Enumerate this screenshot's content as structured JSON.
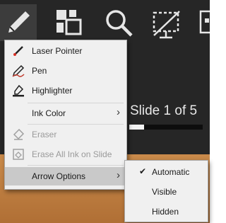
{
  "slide_status": {
    "text": "Slide 1 of 5",
    "progress_fraction": 0.2
  },
  "toolbar": {
    "buttons": [
      {
        "icon": "pen-icon",
        "active": true
      },
      {
        "icon": "see-all-slides-icon"
      },
      {
        "icon": "zoom-magnifier-icon"
      },
      {
        "icon": "screen-toggle-icon"
      },
      {
        "icon": "subtitles-icon"
      }
    ]
  },
  "pointer_menu": {
    "items": [
      {
        "label": "Laser Pointer",
        "icon": "laser-pointer-icon"
      },
      {
        "label": "Pen",
        "icon": "pen-icon"
      },
      {
        "label": "Highlighter",
        "icon": "highlighter-icon"
      },
      {
        "label": "Ink Color"
      },
      {
        "label": "Eraser",
        "icon": "eraser-icon",
        "disabled": true
      },
      {
        "label": "Erase All Ink on Slide",
        "icon": "erase-all-icon",
        "disabled": true
      },
      {
        "label": "Arrow Options",
        "highlighted": true
      }
    ]
  },
  "arrow_options_submenu": {
    "items": [
      {
        "label": "Automatic",
        "checked": true
      },
      {
        "label": "Visible",
        "checked": false
      },
      {
        "label": "Hidden",
        "checked": false
      }
    ]
  },
  "colors": {
    "toolbar_bg": "#262626",
    "menu_bg": "#f0f0f0",
    "highlight": "#c9c9c9",
    "pen_red": "#c0392b"
  }
}
